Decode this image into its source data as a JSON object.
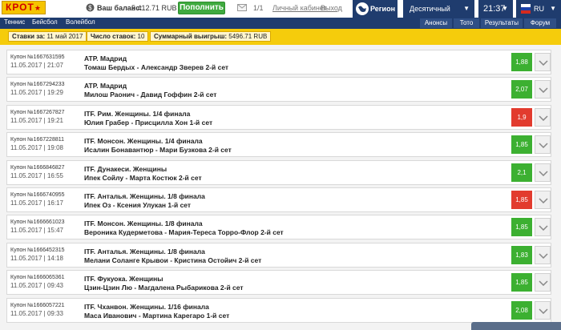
{
  "header": {
    "logo_text": "КРОТ",
    "balance_label": "Ваш баланс:",
    "balance_value": "5 412.71 RUB",
    "topup_label": "Пополнить",
    "messages_count": "1/1",
    "cabinet_link": "Личный кабинет",
    "logout_link": "Выход",
    "region_label": "Регион",
    "odds_format": "Десятичный",
    "time": "21:37",
    "language": "RU"
  },
  "nav": {
    "items": [
      "Теннис",
      "Бейсбол",
      "Волейбол"
    ],
    "buttons": [
      "Анонсы",
      "Тото",
      "Результаты",
      "Форум"
    ]
  },
  "filter": {
    "period_label": "Ставки за:",
    "period_value": "11 май 2017",
    "count_label": "Число ставок:",
    "count_value": "10",
    "total_label": "Суммарный выигрыш:",
    "total_value": "5496.71 RUB"
  },
  "colors": {
    "win": "#3cb031",
    "loss": "#e23b2e",
    "brand": "#1f3c6e",
    "accent": "#f5cc0c"
  },
  "bets": [
    {
      "coupon": "Купон №1667631595",
      "date": "11.05.2017 | 21:07",
      "event": "ATP. Мадрид",
      "match": "Томаш Бердых - Александр Зверев 2-й сет",
      "odd": "1,88",
      "status": "win"
    },
    {
      "coupon": "Купон №1667294233",
      "date": "11.05.2017 | 19:29",
      "event": "ATP. Мадрид",
      "match": "Милош Раонич - Давид Гоффин 2-й сет",
      "odd": "2,07",
      "status": "win"
    },
    {
      "coupon": "Купон №1667267827",
      "date": "11.05.2017 | 19:21",
      "event": "ITF. Рим. Женщины. 1/4 финала",
      "match": "Юлия Грабер - Присцилла Хон 1-й сет",
      "odd": "1,9",
      "status": "loss"
    },
    {
      "coupon": "Купон №1667228811",
      "date": "11.05.2017 | 19:08",
      "event": "ITF. Монсон. Женщины. 1/4 финала",
      "match": "Исалин Бонавантюр - Мари Бузкова 2-й сет",
      "odd": "1,85",
      "status": "win"
    },
    {
      "coupon": "Купон №1666846827",
      "date": "11.05.2017 | 16:55",
      "event": "ITF. Дунакеси. Женщины",
      "match": "Ипек Сойлу - Марта Костюк 2-й сет",
      "odd": "2,1",
      "status": "win"
    },
    {
      "coupon": "Купон №1666740955",
      "date": "11.05.2017 | 16:17",
      "event": "ITF. Анталья. Женщины. 1/8 финала",
      "match": "Ипек Оз - Ксения Улукан 1-й сет",
      "odd": "1,85",
      "status": "loss"
    },
    {
      "coupon": "Купон №1666661023",
      "date": "11.05.2017 | 15:47",
      "event": "ITF. Монсон. Женщины. 1/8 финала",
      "match": "Вероника Кудерметова - Мария-Тереса Торро-Флор 2-й сет",
      "odd": "1,85",
      "status": "win"
    },
    {
      "coupon": "Купон №1666452315",
      "date": "11.05.2017 | 14:18",
      "event": "ITF. Анталья. Женщины. 1/8 финала",
      "match": "Мелани Соланге Крывои - Кристина Остойич 2-й сет",
      "odd": "1,83",
      "status": "win"
    },
    {
      "coupon": "Купон №1666065361",
      "date": "11.05.2017 | 09:43",
      "event": "ITF. Фукуока. Женщины",
      "match": "Цзин-Цзин Лю - Магдалена Рыбарикова 2-й сет",
      "odd": "1,85",
      "status": "win"
    },
    {
      "coupon": "Купон №1666057221",
      "date": "11.05.2017 | 09:33",
      "event": "ITF. Чханвон. Женщины. 1/16 финала",
      "match": "Маса Иванович - Мартина Карегаро 1-й сет",
      "odd": "2,08",
      "status": "win"
    }
  ]
}
